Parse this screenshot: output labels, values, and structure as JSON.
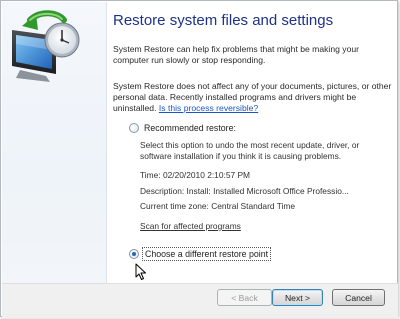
{
  "window": {
    "title": "Restore system files and settings"
  },
  "intro": {
    "paragraph1": "System Restore can help fix problems that might be making your computer run slowly or stop responding.",
    "paragraph2": "System Restore does not affect any of your documents, pictures, or other personal data. Recently installed programs and drivers might be uninstalled.",
    "reversible_link": "Is this process reversible?"
  },
  "options": {
    "recommended": {
      "label": "Recommended restore:",
      "checked": false,
      "description": "Select this option to undo the most recent update, driver, or software installation if you think it is causing problems.",
      "time": "Time: 02/20/2010 2:10:57 PM",
      "restore_description": "Description: Install: Installed Microsoft Office Professio...",
      "time_zone": "Current time zone: Central Standard Time",
      "scan_link": "Scan for affected programs"
    },
    "different": {
      "label": "Choose a different restore point",
      "checked": true
    }
  },
  "buttons": {
    "back": "< Back",
    "next": "Next >",
    "cancel": "Cancel"
  },
  "icons": {
    "logo": "system-restore-icon",
    "cursor": "mouse-pointer-icon"
  },
  "colors": {
    "title": "#1e3287",
    "link": "#1a55c5",
    "default_button_border": "#3c7fb1"
  }
}
